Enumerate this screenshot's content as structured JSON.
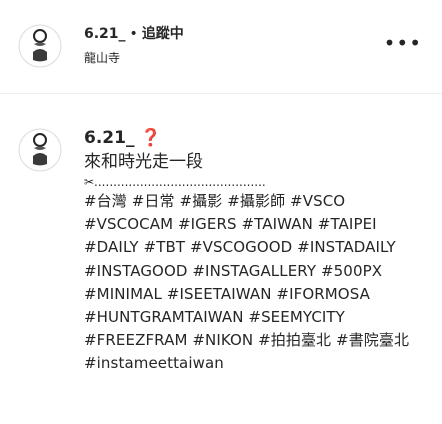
{
  "header": {
    "username": "6.21_",
    "separator": "•",
    "follow_status": "追蹤中",
    "location": "龍山寺",
    "more_icon": "more-horizontal-icon"
  },
  "comment": {
    "username": "6.21_",
    "emoji": "❓",
    "text_line_1": "來和時光走一段",
    "text_line_2": "✂.............................................",
    "caption": "#台灣 #日常 #攝影 #攝影師 #VSCO #VSCOCAM #IGERS #TAIWAN #TAIPEI #DAILY #TBT #VSCOGOOD #INSTADAILY #INSTAGOOD #INSTAGALLERY #500PX #MINIMAL #ISEETAIWAN #IFORMOSA #HUNTGRAMTAIWAN #SEEMYCITY #FREEZFRAM #NIKON #拍拍臺北 #書院臺北",
    "caption_tail": "#instameettaiwan"
  }
}
